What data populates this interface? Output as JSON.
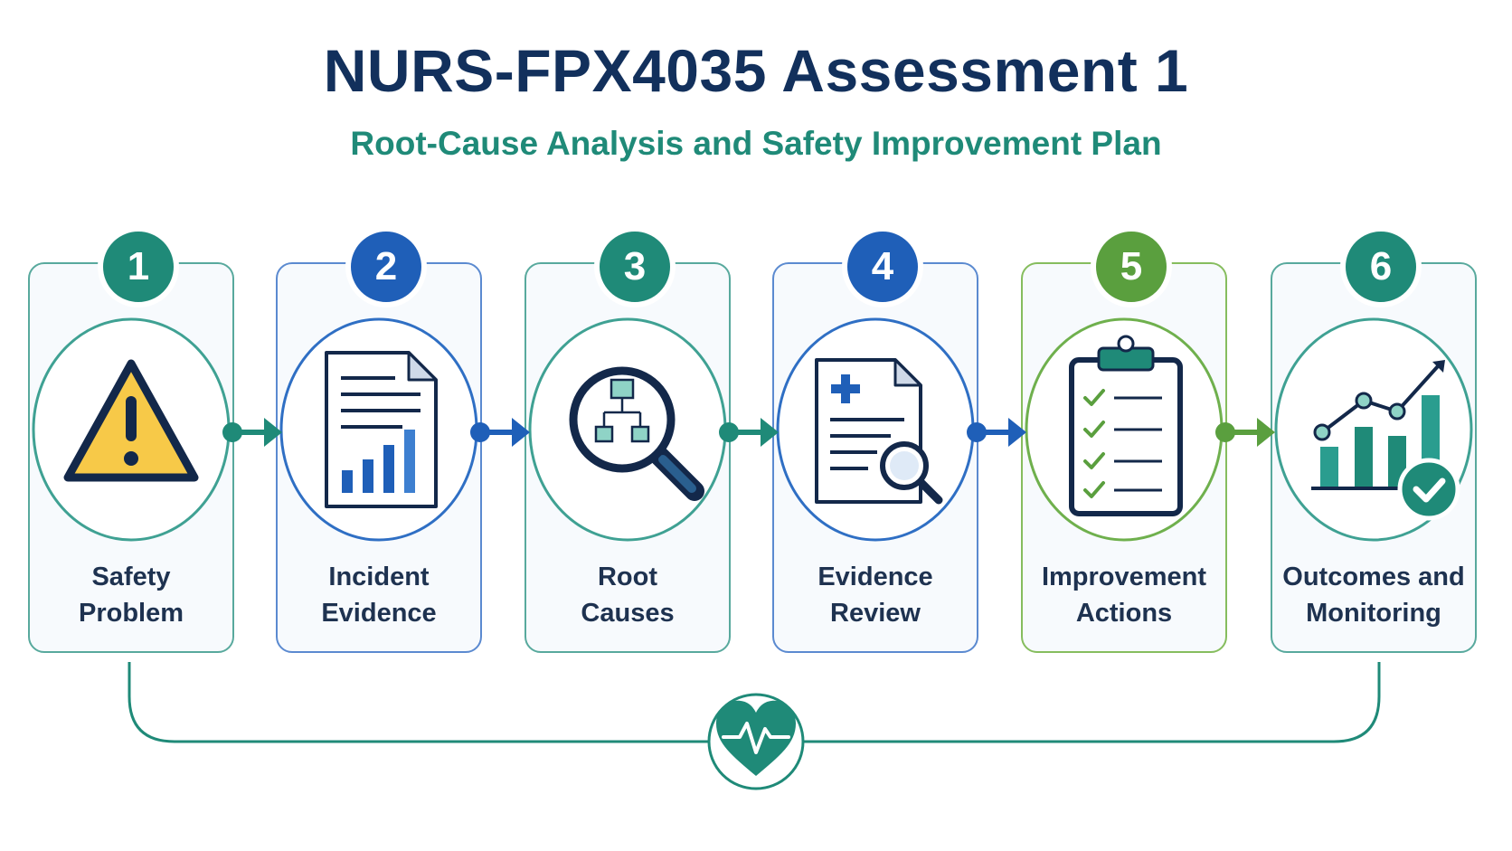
{
  "header": {
    "title": "NURS-FPX4035 Assessment 1",
    "subtitle": "Root-Cause Analysis and Safety Improvement Plan"
  },
  "steps": [
    {
      "number": "1",
      "line1": "Safety",
      "line2": "Problem",
      "icon": "warning-triangle-icon",
      "color": "#1f8a78"
    },
    {
      "number": "2",
      "line1": "Incident",
      "line2": "Evidence",
      "icon": "document-chart-icon",
      "color": "#1f5fb8"
    },
    {
      "number": "3",
      "line1": "Root",
      "line2": "Causes",
      "icon": "magnifier-hierarchy-icon",
      "color": "#1f8a78"
    },
    {
      "number": "4",
      "line1": "Evidence",
      "line2": "Review",
      "icon": "medical-document-search-icon",
      "color": "#1f5fb8"
    },
    {
      "number": "5",
      "line1": "Improvement",
      "line2": "Actions",
      "icon": "checklist-clipboard-icon",
      "color": "#5a9f3e"
    },
    {
      "number": "6",
      "line1": "Outcomes and",
      "line2": "Monitoring",
      "icon": "growth-chart-check-icon",
      "color": "#1f8a78"
    }
  ],
  "footer_icon": "heart-pulse-icon",
  "colors": {
    "navy": "#12305c",
    "teal": "#1f8a78",
    "blue": "#1f5fb8",
    "green": "#5a9f3e",
    "warning": "#f7c948"
  }
}
